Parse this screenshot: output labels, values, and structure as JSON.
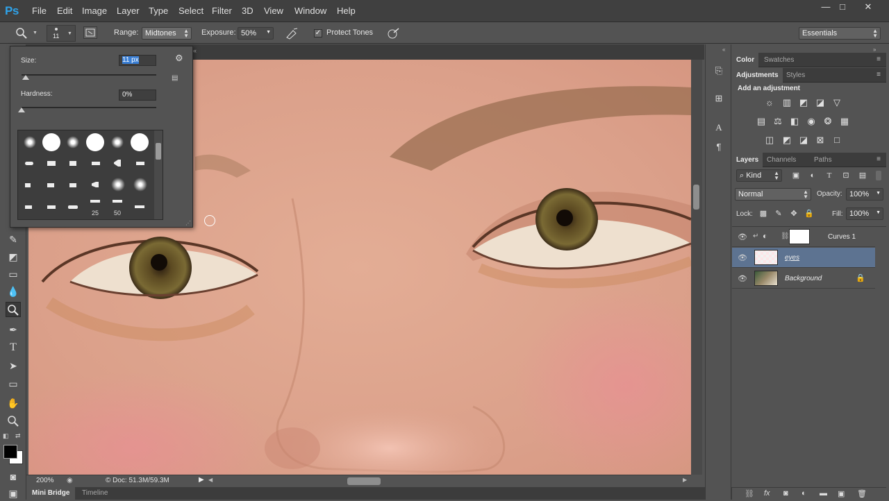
{
  "app": {
    "logo": "Ps"
  },
  "menu": [
    "File",
    "Edit",
    "Image",
    "Layer",
    "Type",
    "Select",
    "Filter",
    "3D",
    "View",
    "Window",
    "Help"
  ],
  "window_controls": {
    "minimize": "—",
    "maximize": "□",
    "close": "✕"
  },
  "options": {
    "brush_size_value": "11",
    "range_label": "Range:",
    "range_value": "Midtones",
    "exposure_label": "Exposure:",
    "exposure_value": "50%",
    "protect_tones_label": "Protect Tones",
    "protect_tones_checked": true,
    "workspace": "Essentials"
  },
  "brush_picker": {
    "size_label": "Size:",
    "size_value": "11 px",
    "hardness_label": "Hardness:",
    "hardness_value": "0%",
    "size_level": 0.03,
    "hardness_level": 0.0,
    "brush_tip_labels": [
      "25",
      "50"
    ]
  },
  "status": {
    "zoom": "200%",
    "doc": "© Doc: 51.3M/59.3M"
  },
  "bottom_tabs": [
    "Mini Bridge",
    "Timeline"
  ],
  "color_panel": {
    "tabs": [
      "Color",
      "Swatches"
    ]
  },
  "adjustments_panel": {
    "tabs": [
      "Adjustments",
      "Styles"
    ],
    "title": "Add an adjustment"
  },
  "layers_panel": {
    "tabs": [
      "Layers",
      "Channels",
      "Paths"
    ],
    "filter_kind": "Kind",
    "blend_mode": "Normal",
    "opacity_label": "Opacity:",
    "opacity_value": "100%",
    "lock_label": "Lock:",
    "fill_label": "Fill:",
    "fill_value": "100%",
    "layers": [
      {
        "name": "Curves 1",
        "selected": false
      },
      {
        "name": "eyes",
        "selected": true
      },
      {
        "name": "Background",
        "selected": false
      }
    ]
  },
  "colors": {
    "accent": "#2fa3ea",
    "selected_layer": "#5d7391",
    "panel_bg": "#535353",
    "dark_bg": "#3c3c3c"
  }
}
